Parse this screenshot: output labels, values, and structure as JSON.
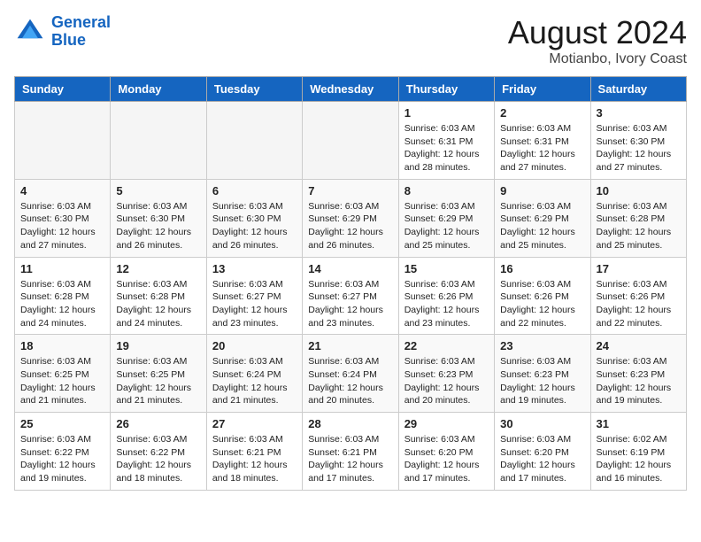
{
  "header": {
    "logo_line1": "General",
    "logo_line2": "Blue",
    "title": "August 2024",
    "subtitle": "Motianbo, Ivory Coast"
  },
  "days_of_week": [
    "Sunday",
    "Monday",
    "Tuesday",
    "Wednesday",
    "Thursday",
    "Friday",
    "Saturday"
  ],
  "weeks": [
    [
      {
        "day": "",
        "info": ""
      },
      {
        "day": "",
        "info": ""
      },
      {
        "day": "",
        "info": ""
      },
      {
        "day": "",
        "info": ""
      },
      {
        "day": "1",
        "info": "Sunrise: 6:03 AM\nSunset: 6:31 PM\nDaylight: 12 hours\nand 28 minutes."
      },
      {
        "day": "2",
        "info": "Sunrise: 6:03 AM\nSunset: 6:31 PM\nDaylight: 12 hours\nand 27 minutes."
      },
      {
        "day": "3",
        "info": "Sunrise: 6:03 AM\nSunset: 6:30 PM\nDaylight: 12 hours\nand 27 minutes."
      }
    ],
    [
      {
        "day": "4",
        "info": "Sunrise: 6:03 AM\nSunset: 6:30 PM\nDaylight: 12 hours\nand 27 minutes."
      },
      {
        "day": "5",
        "info": "Sunrise: 6:03 AM\nSunset: 6:30 PM\nDaylight: 12 hours\nand 26 minutes."
      },
      {
        "day": "6",
        "info": "Sunrise: 6:03 AM\nSunset: 6:30 PM\nDaylight: 12 hours\nand 26 minutes."
      },
      {
        "day": "7",
        "info": "Sunrise: 6:03 AM\nSunset: 6:29 PM\nDaylight: 12 hours\nand 26 minutes."
      },
      {
        "day": "8",
        "info": "Sunrise: 6:03 AM\nSunset: 6:29 PM\nDaylight: 12 hours\nand 25 minutes."
      },
      {
        "day": "9",
        "info": "Sunrise: 6:03 AM\nSunset: 6:29 PM\nDaylight: 12 hours\nand 25 minutes."
      },
      {
        "day": "10",
        "info": "Sunrise: 6:03 AM\nSunset: 6:28 PM\nDaylight: 12 hours\nand 25 minutes."
      }
    ],
    [
      {
        "day": "11",
        "info": "Sunrise: 6:03 AM\nSunset: 6:28 PM\nDaylight: 12 hours\nand 24 minutes."
      },
      {
        "day": "12",
        "info": "Sunrise: 6:03 AM\nSunset: 6:28 PM\nDaylight: 12 hours\nand 24 minutes."
      },
      {
        "day": "13",
        "info": "Sunrise: 6:03 AM\nSunset: 6:27 PM\nDaylight: 12 hours\nand 23 minutes."
      },
      {
        "day": "14",
        "info": "Sunrise: 6:03 AM\nSunset: 6:27 PM\nDaylight: 12 hours\nand 23 minutes."
      },
      {
        "day": "15",
        "info": "Sunrise: 6:03 AM\nSunset: 6:26 PM\nDaylight: 12 hours\nand 23 minutes."
      },
      {
        "day": "16",
        "info": "Sunrise: 6:03 AM\nSunset: 6:26 PM\nDaylight: 12 hours\nand 22 minutes."
      },
      {
        "day": "17",
        "info": "Sunrise: 6:03 AM\nSunset: 6:26 PM\nDaylight: 12 hours\nand 22 minutes."
      }
    ],
    [
      {
        "day": "18",
        "info": "Sunrise: 6:03 AM\nSunset: 6:25 PM\nDaylight: 12 hours\nand 21 minutes."
      },
      {
        "day": "19",
        "info": "Sunrise: 6:03 AM\nSunset: 6:25 PM\nDaylight: 12 hours\nand 21 minutes."
      },
      {
        "day": "20",
        "info": "Sunrise: 6:03 AM\nSunset: 6:24 PM\nDaylight: 12 hours\nand 21 minutes."
      },
      {
        "day": "21",
        "info": "Sunrise: 6:03 AM\nSunset: 6:24 PM\nDaylight: 12 hours\nand 20 minutes."
      },
      {
        "day": "22",
        "info": "Sunrise: 6:03 AM\nSunset: 6:23 PM\nDaylight: 12 hours\nand 20 minutes."
      },
      {
        "day": "23",
        "info": "Sunrise: 6:03 AM\nSunset: 6:23 PM\nDaylight: 12 hours\nand 19 minutes."
      },
      {
        "day": "24",
        "info": "Sunrise: 6:03 AM\nSunset: 6:23 PM\nDaylight: 12 hours\nand 19 minutes."
      }
    ],
    [
      {
        "day": "25",
        "info": "Sunrise: 6:03 AM\nSunset: 6:22 PM\nDaylight: 12 hours\nand 19 minutes."
      },
      {
        "day": "26",
        "info": "Sunrise: 6:03 AM\nSunset: 6:22 PM\nDaylight: 12 hours\nand 18 minutes."
      },
      {
        "day": "27",
        "info": "Sunrise: 6:03 AM\nSunset: 6:21 PM\nDaylight: 12 hours\nand 18 minutes."
      },
      {
        "day": "28",
        "info": "Sunrise: 6:03 AM\nSunset: 6:21 PM\nDaylight: 12 hours\nand 17 minutes."
      },
      {
        "day": "29",
        "info": "Sunrise: 6:03 AM\nSunset: 6:20 PM\nDaylight: 12 hours\nand 17 minutes."
      },
      {
        "day": "30",
        "info": "Sunrise: 6:03 AM\nSunset: 6:20 PM\nDaylight: 12 hours\nand 17 minutes."
      },
      {
        "day": "31",
        "info": "Sunrise: 6:02 AM\nSunset: 6:19 PM\nDaylight: 12 hours\nand 16 minutes."
      }
    ]
  ]
}
